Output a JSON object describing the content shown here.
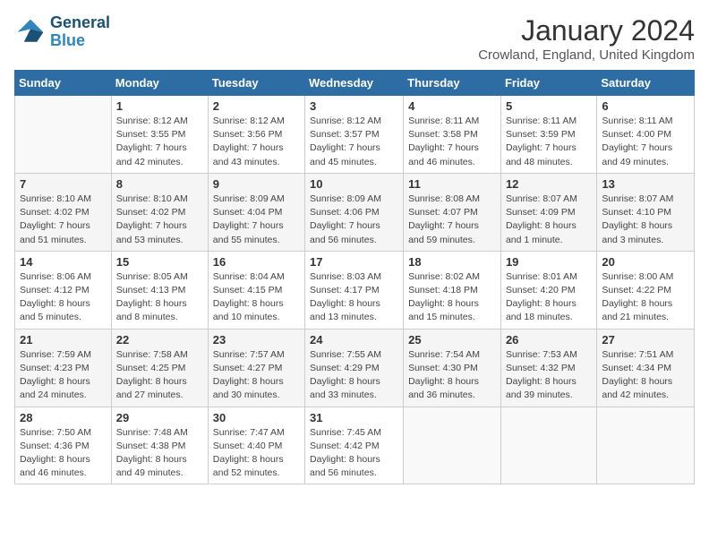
{
  "header": {
    "logo_line1": "General",
    "logo_line2": "Blue",
    "title": "January 2024",
    "subtitle": "Crowland, England, United Kingdom"
  },
  "days_of_week": [
    "Sunday",
    "Monday",
    "Tuesday",
    "Wednesday",
    "Thursday",
    "Friday",
    "Saturday"
  ],
  "weeks": [
    [
      {
        "day": "",
        "info": ""
      },
      {
        "day": "1",
        "info": "Sunrise: 8:12 AM\nSunset: 3:55 PM\nDaylight: 7 hours\nand 42 minutes."
      },
      {
        "day": "2",
        "info": "Sunrise: 8:12 AM\nSunset: 3:56 PM\nDaylight: 7 hours\nand 43 minutes."
      },
      {
        "day": "3",
        "info": "Sunrise: 8:12 AM\nSunset: 3:57 PM\nDaylight: 7 hours\nand 45 minutes."
      },
      {
        "day": "4",
        "info": "Sunrise: 8:11 AM\nSunset: 3:58 PM\nDaylight: 7 hours\nand 46 minutes."
      },
      {
        "day": "5",
        "info": "Sunrise: 8:11 AM\nSunset: 3:59 PM\nDaylight: 7 hours\nand 48 minutes."
      },
      {
        "day": "6",
        "info": "Sunrise: 8:11 AM\nSunset: 4:00 PM\nDaylight: 7 hours\nand 49 minutes."
      }
    ],
    [
      {
        "day": "7",
        "info": ""
      },
      {
        "day": "8",
        "info": "Sunrise: 8:10 AM\nSunset: 4:02 PM\nDaylight: 7 hours\nand 53 minutes."
      },
      {
        "day": "9",
        "info": "Sunrise: 8:09 AM\nSunset: 4:04 PM\nDaylight: 7 hours\nand 55 minutes."
      },
      {
        "day": "10",
        "info": "Sunrise: 8:09 AM\nSunset: 4:06 PM\nDaylight: 7 hours\nand 56 minutes."
      },
      {
        "day": "11",
        "info": "Sunrise: 8:08 AM\nSunset: 4:07 PM\nDaylight: 7 hours\nand 59 minutes."
      },
      {
        "day": "12",
        "info": "Sunrise: 8:07 AM\nSunset: 4:09 PM\nDaylight: 8 hours\nand 1 minute."
      },
      {
        "day": "13",
        "info": "Sunrise: 8:07 AM\nSunset: 4:10 PM\nDaylight: 8 hours\nand 3 minutes."
      }
    ],
    [
      {
        "day": "14",
        "info": ""
      },
      {
        "day": "15",
        "info": "Sunrise: 8:05 AM\nSunset: 4:13 PM\nDaylight: 8 hours\nand 8 minutes."
      },
      {
        "day": "16",
        "info": "Sunrise: 8:04 AM\nSunset: 4:15 PM\nDaylight: 8 hours\nand 10 minutes."
      },
      {
        "day": "17",
        "info": "Sunrise: 8:03 AM\nSunset: 4:17 PM\nDaylight: 8 hours\nand 13 minutes."
      },
      {
        "day": "18",
        "info": "Sunrise: 8:02 AM\nSunset: 4:18 PM\nDaylight: 8 hours\nand 15 minutes."
      },
      {
        "day": "19",
        "info": "Sunrise: 8:01 AM\nSunset: 4:20 PM\nDaylight: 8 hours\nand 18 minutes."
      },
      {
        "day": "20",
        "info": "Sunrise: 8:00 AM\nSunset: 4:22 PM\nDaylight: 8 hours\nand 21 minutes."
      }
    ],
    [
      {
        "day": "21",
        "info": ""
      },
      {
        "day": "22",
        "info": "Sunrise: 7:58 AM\nSunset: 4:25 PM\nDaylight: 8 hours\nand 27 minutes."
      },
      {
        "day": "23",
        "info": "Sunrise: 7:57 AM\nSunset: 4:27 PM\nDaylight: 8 hours\nand 30 minutes."
      },
      {
        "day": "24",
        "info": "Sunrise: 7:55 AM\nSunset: 4:29 PM\nDaylight: 8 hours\nand 33 minutes."
      },
      {
        "day": "25",
        "info": "Sunrise: 7:54 AM\nSunset: 4:30 PM\nDaylight: 8 hours\nand 36 minutes."
      },
      {
        "day": "26",
        "info": "Sunrise: 7:53 AM\nSunset: 4:32 PM\nDaylight: 8 hours\nand 39 minutes."
      },
      {
        "day": "27",
        "info": "Sunrise: 7:51 AM\nSunset: 4:34 PM\nDaylight: 8 hours\nand 42 minutes."
      }
    ],
    [
      {
        "day": "28",
        "info": ""
      },
      {
        "day": "29",
        "info": "Sunrise: 7:48 AM\nSunset: 4:38 PM\nDaylight: 8 hours\nand 49 minutes."
      },
      {
        "day": "30",
        "info": "Sunrise: 7:47 AM\nSunset: 4:40 PM\nDaylight: 8 hours\nand 52 minutes."
      },
      {
        "day": "31",
        "info": "Sunrise: 7:45 AM\nSunset: 4:42 PM\nDaylight: 8 hours\nand 56 minutes."
      },
      {
        "day": "",
        "info": ""
      },
      {
        "day": "",
        "info": ""
      },
      {
        "day": "",
        "info": ""
      }
    ]
  ],
  "week1_sunday": "Sunrise: 8:10 AM\nSunset: 4:02 PM\nDaylight: 7 hours\nand 51 minutes.",
  "week2_sunday_info": "Sunrise: 8:06 AM\nSunset: 4:12 PM\nDaylight: 8 hours\nand 5 minutes.",
  "week3_sunday_info": "Sunrise: 7:59 AM\nSunset: 4:23 PM\nDaylight: 8 hours\nand 24 minutes.",
  "week4_sunday_info": "Sunrise: 7:50 AM\nSunset: 4:36 PM\nDaylight: 8 hours\nand 46 minutes."
}
